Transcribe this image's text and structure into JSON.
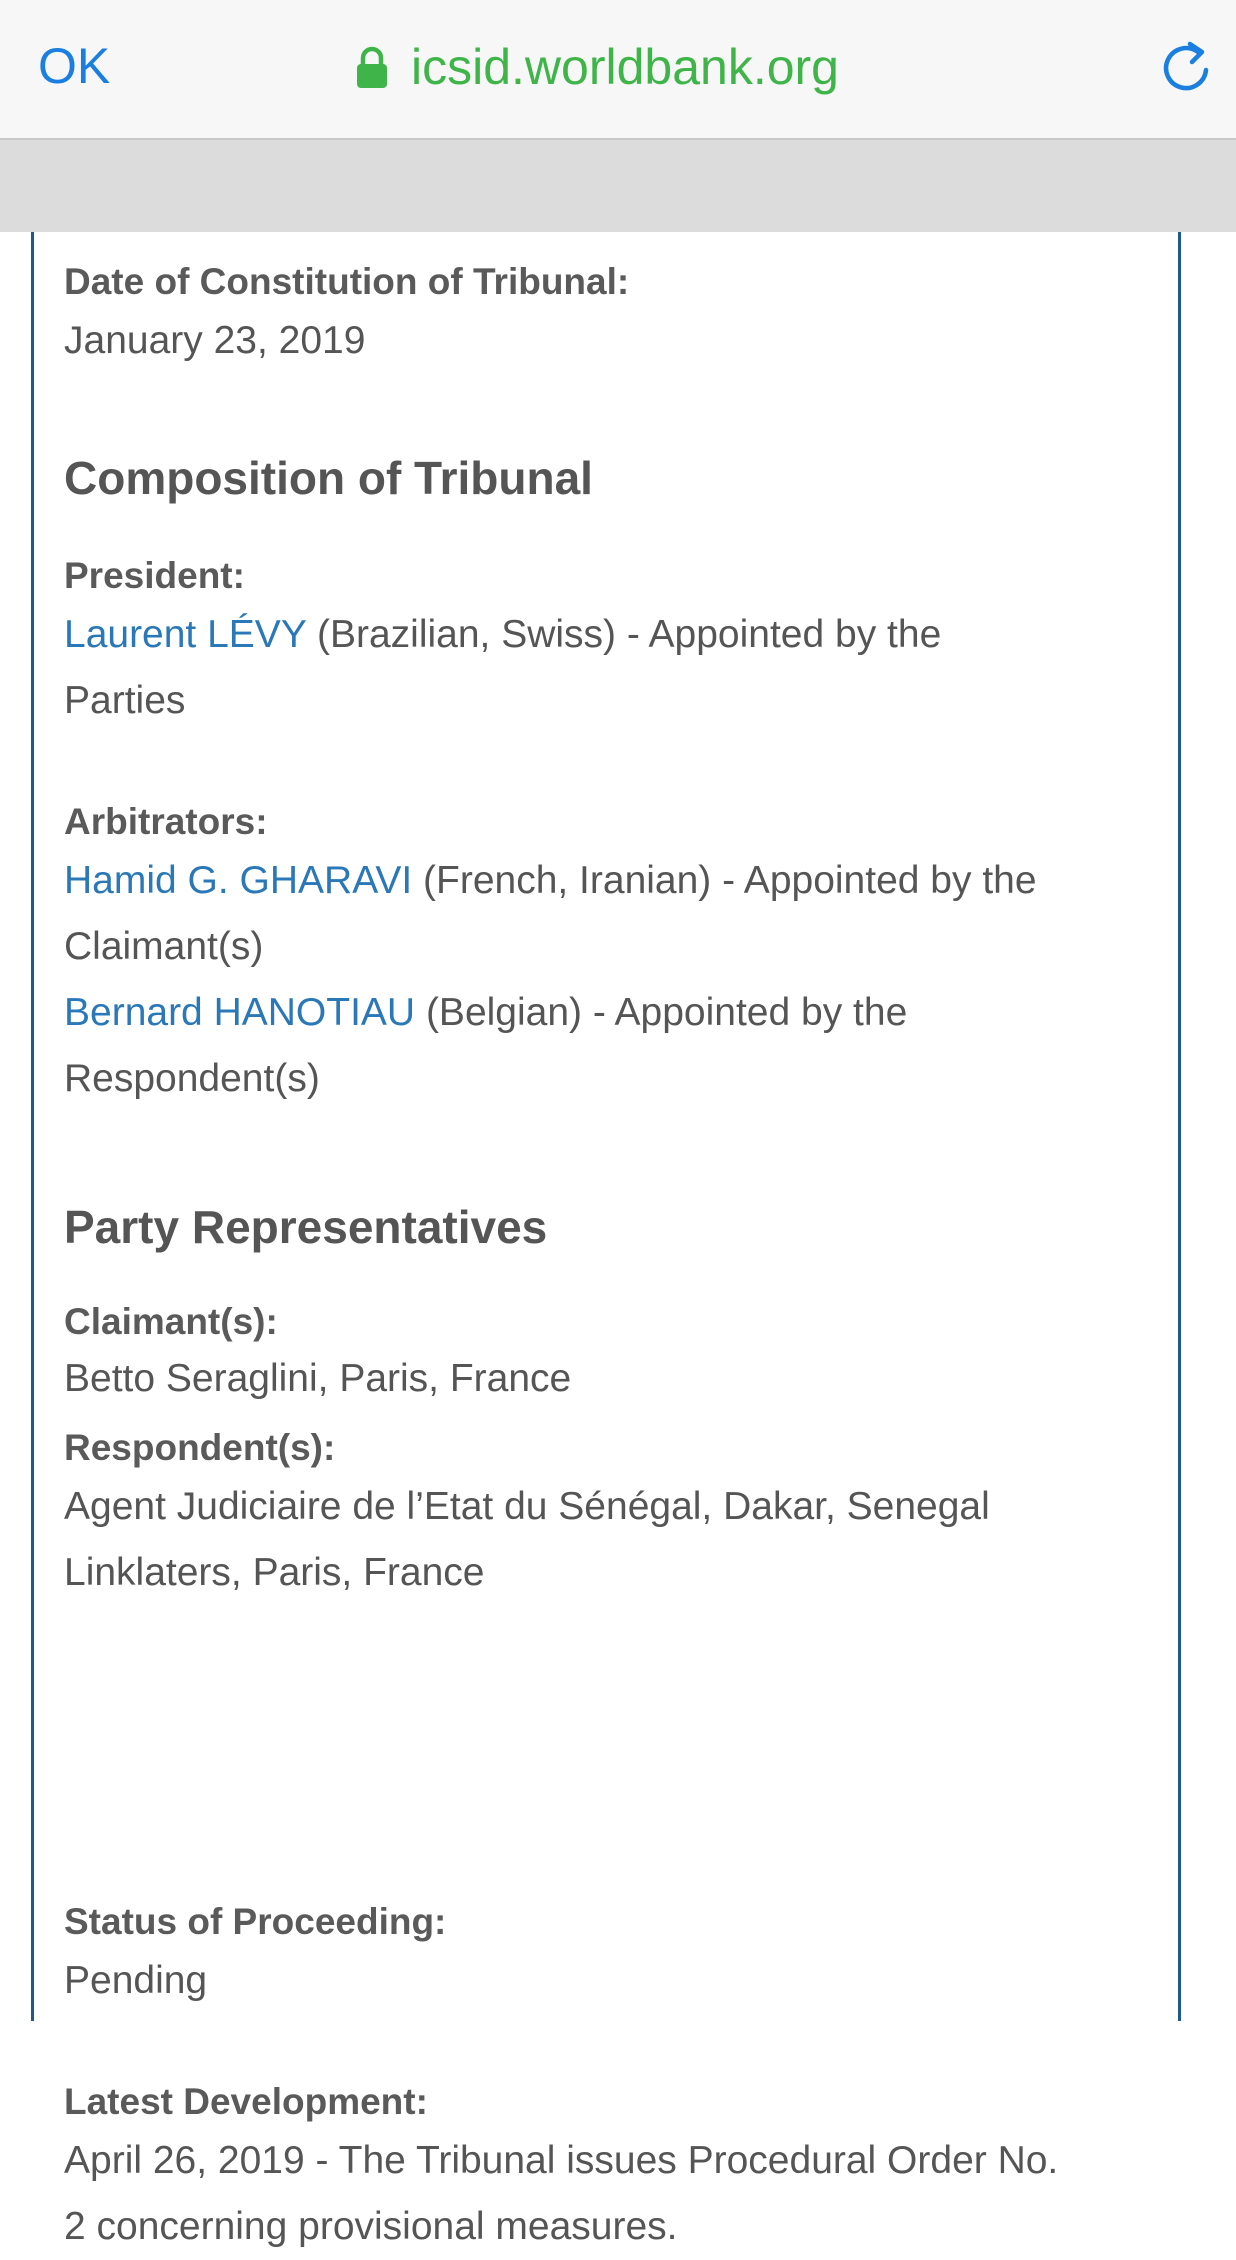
{
  "browser": {
    "ok_label": "OK",
    "url": "icsid.worldbank.org",
    "lock_icon": "lock-icon",
    "reload_icon": "reload-icon",
    "accent_color": "#1a7fe0",
    "secure_color": "#3fb549"
  },
  "case": {
    "constitution": {
      "label": "Date of Constitution of Tribunal:",
      "value": "January 23, 2019"
    },
    "composition": {
      "heading": "Composition of Tribunal",
      "president_label": "President:",
      "president": {
        "name": "Laurent LÉVY",
        "detail_line1": " (Brazilian, Swiss) - Appointed by the",
        "detail_line2": "Parties"
      },
      "arbitrators_label": "Arbitrators:",
      "arbitrators": [
        {
          "name": "Hamid G. GHARAVI",
          "detail_line1": " (French, Iranian) - Appointed by the",
          "detail_line2": "Claimant(s)"
        },
        {
          "name": "Bernard HANOTIAU",
          "detail_line1": " (Belgian) - Appointed by the",
          "detail_line2": "Respondent(s)"
        }
      ]
    },
    "representatives": {
      "heading": "Party Representatives",
      "claimant_label": "Claimant(s):",
      "claimants": [
        "Betto Seraglini, Paris, France"
      ],
      "respondent_label": "Respondent(s):",
      "respondents": [
        "Agent Judiciaire de l’Etat du Sénégal, Dakar, Senegal",
        "Linklaters, Paris, France"
      ]
    },
    "status": {
      "label": "Status of Proceeding:",
      "value": "Pending"
    },
    "latest": {
      "label": "Latest Development:",
      "line1": "April 26, 2019 - The Tribunal issues Procedural Order No.",
      "line2": "2 concerning provisional measures."
    }
  }
}
